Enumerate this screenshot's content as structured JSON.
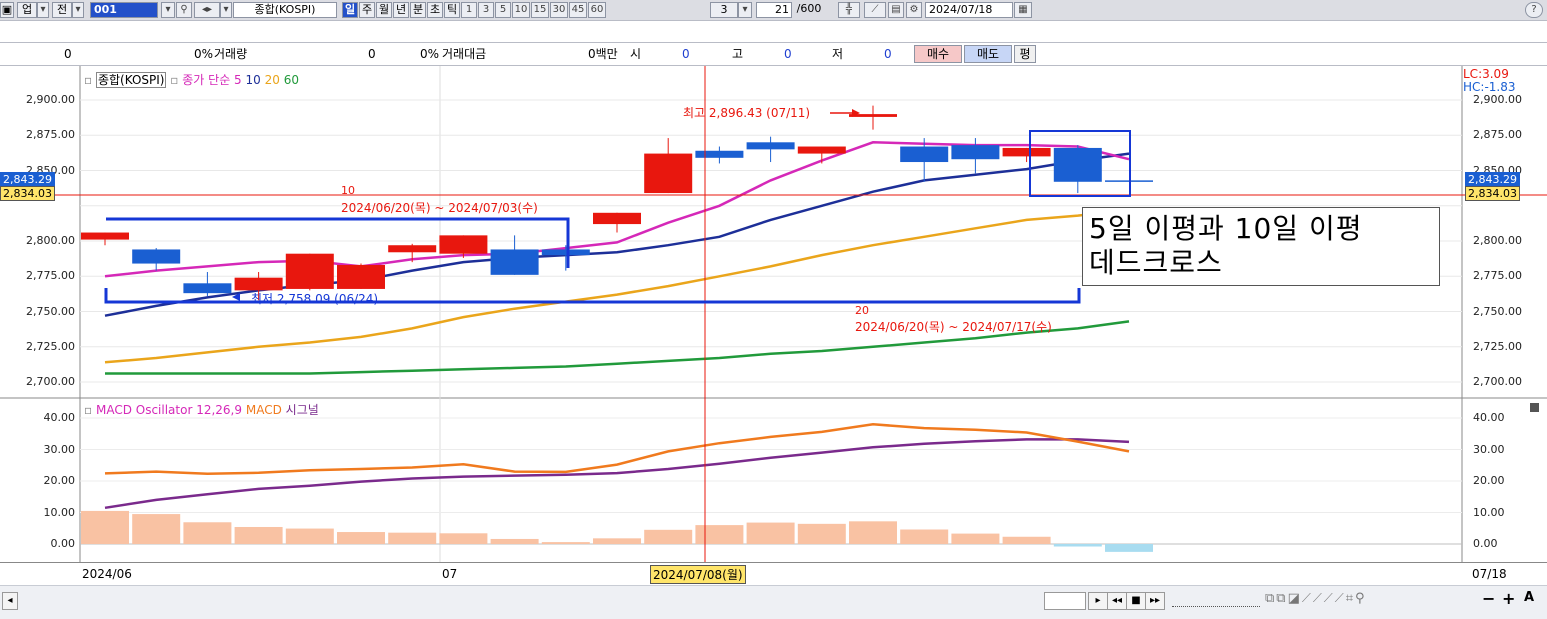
{
  "toolbar": {
    "market_tab": "업",
    "prev_label": "전",
    "code": "001",
    "index_name": "종합(KOSPI)",
    "periods": [
      "일",
      "주",
      "월",
      "년",
      "분",
      "초",
      "틱"
    ],
    "minute_options": [
      "1",
      "3",
      "5",
      "10",
      "15",
      "30",
      "45",
      "60"
    ],
    "interval_value": "3",
    "count_value": "21",
    "count_max": "/600",
    "date_value": "2024/07/18"
  },
  "quote_bar": {
    "price": "0",
    "change_pct": "0%",
    "volume_label": "거래량",
    "volume": "0",
    "volume_pct": "0%",
    "amount_label": "거래대금",
    "amount_value": "0백만",
    "open_label": "시",
    "open": "0",
    "high_label": "고",
    "high": "0",
    "low_label": "저",
    "low": "0",
    "buy_label": "매수",
    "sell_label": "매도",
    "eval_label": "평"
  },
  "legend": {
    "title": "종합(KOSPI)",
    "ma_label": "종가 단순 5",
    "ma10": "10",
    "ma20": "20",
    "ma60": "60"
  },
  "macd_legend": {
    "title": "MACD Oscillator 12,26,9",
    "macd": "MACD",
    "signal": "시그널"
  },
  "price_axis_labels": [
    "2,900.00",
    "2,875.00",
    "2,850.00",
    "2,800.00",
    "2,775.00",
    "2,750.00",
    "2,725.00",
    "2,700.00"
  ],
  "macd_axis_labels": [
    "40.00",
    "30.00",
    "20.00",
    "10.00",
    "0.00"
  ],
  "current_price_tag": "2,834.03",
  "ma_tag": "2,843.29",
  "lc_label": "LC:3.09",
  "hc_label": "HC:-1.83",
  "annotations": {
    "high": "최고 2,896.43 (07/11)",
    "low": "최저 2,758.09 (06/24)",
    "range10_period": "10",
    "range10_dates": "2024/06/20(목) ~ 2024/07/03(수)",
    "range20_period": "20",
    "range20_dates": "2024/06/20(목) ~ 2024/07/17(수)",
    "note_line1": "5일 이평과 10일 이평",
    "note_line2": "데드크로스"
  },
  "x_axis": {
    "labels": [
      "2024/06",
      "07"
    ],
    "cursor_date": "2024/07/08(월)",
    "right_label": "07/18"
  },
  "colors": {
    "up": "#e8170e",
    "down": "#1a5fd2",
    "ma5": "#d528b8",
    "ma10": "#1d2f98",
    "ma20": "#eaa51b",
    "ma60": "#219a3b",
    "macd": "#f07a1e",
    "signal": "#7a2a8c",
    "hist_pos": "#f9c2a3",
    "hist_neg": "#a8dcf0"
  },
  "chart_data": [
    {
      "type": "candlestick",
      "series_name": "종합(KOSPI)",
      "ylim": [
        2700,
        2900
      ],
      "candles": [
        {
          "o": 2801,
          "h": 2806,
          "l": 2797,
          "c": 2806
        },
        {
          "o": 2794,
          "h": 2795,
          "l": 2779,
          "c": 2784
        },
        {
          "o": 2770,
          "h": 2778,
          "l": 2761,
          "c": 2763
        },
        {
          "o": 2765,
          "h": 2778,
          "l": 2758,
          "c": 2774
        },
        {
          "o": 2766,
          "h": 2791,
          "l": 2765,
          "c": 2791
        },
        {
          "o": 2766,
          "h": 2784,
          "l": 2766,
          "c": 2783
        },
        {
          "o": 2792,
          "h": 2798,
          "l": 2785,
          "c": 2797
        },
        {
          "o": 2791,
          "h": 2804,
          "l": 2788,
          "c": 2804
        },
        {
          "o": 2794,
          "h": 2804,
          "l": 2776,
          "c": 2776
        },
        {
          "o": 2794,
          "h": 2797,
          "l": 2779,
          "c": 2790
        },
        {
          "o": 2812,
          "h": 2820,
          "l": 2806,
          "c": 2820
        },
        {
          "o": 2834,
          "h": 2873,
          "l": 2834,
          "c": 2862
        },
        {
          "o": 2864,
          "h": 2867,
          "l": 2855,
          "c": 2859
        },
        {
          "o": 2870,
          "h": 2874,
          "l": 2856,
          "c": 2865
        },
        {
          "o": 2862,
          "h": 2867,
          "l": 2855,
          "c": 2867
        },
        {
          "o": 2888,
          "h": 2896,
          "l": 2879,
          "c": 2890
        },
        {
          "o": 2867,
          "h": 2873,
          "l": 2842,
          "c": 2856
        },
        {
          "o": 2868,
          "h": 2873,
          "l": 2848,
          "c": 2858
        },
        {
          "o": 2860,
          "h": 2866,
          "l": 2856,
          "c": 2866
        },
        {
          "o": 2866,
          "h": 2868,
          "l": 2834,
          "c": 2842
        },
        {
          "o": 2843,
          "h": 2843,
          "l": 2843,
          "c": 2843
        }
      ],
      "ma5": [
        2775,
        2779,
        2782,
        2785,
        2786,
        2782,
        2787,
        2790,
        2791,
        2795,
        2799,
        2813,
        2825,
        2843,
        2857,
        2870,
        2869,
        2868,
        2868,
        2867,
        2858
      ],
      "ma10": [
        2747,
        2754,
        2760,
        2765,
        2769,
        2772,
        2779,
        2785,
        2788,
        2790,
        2792,
        2797,
        2803,
        2815,
        2825,
        2835,
        2843,
        2847,
        2851,
        2857,
        2862
      ],
      "ma20": [
        2714,
        2717,
        2721,
        2725,
        2728,
        2732,
        2738,
        2746,
        2752,
        2757,
        2762,
        2768,
        2775,
        2782,
        2790,
        2797,
        2803,
        2809,
        2815,
        2818,
        2822
      ],
      "ma60": [
        2706,
        2706,
        2706,
        2706,
        2706,
        2707,
        2708,
        2709,
        2710,
        2711,
        2713,
        2715,
        2717,
        2720,
        2722,
        2725,
        2728,
        2731,
        2735,
        2738,
        2743
      ]
    },
    {
      "type": "bar",
      "series_name": "MACD Oscillator 12,26,9",
      "ylim": [
        0,
        40
      ],
      "oscillator": [
        10.5,
        9.5,
        6.9,
        5.4,
        4.9,
        3.8,
        3.6,
        3.4,
        1.6,
        0.6,
        1.8,
        4.5,
        6.0,
        6.8,
        6.4,
        7.2,
        4.6,
        3.3,
        2.3,
        -0.8,
        -2.5
      ],
      "macd": [
        22.4,
        23.0,
        22.3,
        22.6,
        23.4,
        23.8,
        24.3,
        25.3,
        23.0,
        22.9,
        25.2,
        29.4,
        32.0,
        34.0,
        35.6,
        38.0,
        36.8,
        36.3,
        35.4,
        32.5,
        29.4
      ],
      "signal": [
        11.5,
        14.0,
        15.8,
        17.5,
        18.5,
        19.8,
        20.8,
        21.4,
        21.7,
        22.0,
        22.5,
        23.8,
        25.5,
        27.4,
        29.0,
        30.7,
        31.8,
        32.6,
        33.2,
        33.2,
        32.4
      ]
    }
  ]
}
